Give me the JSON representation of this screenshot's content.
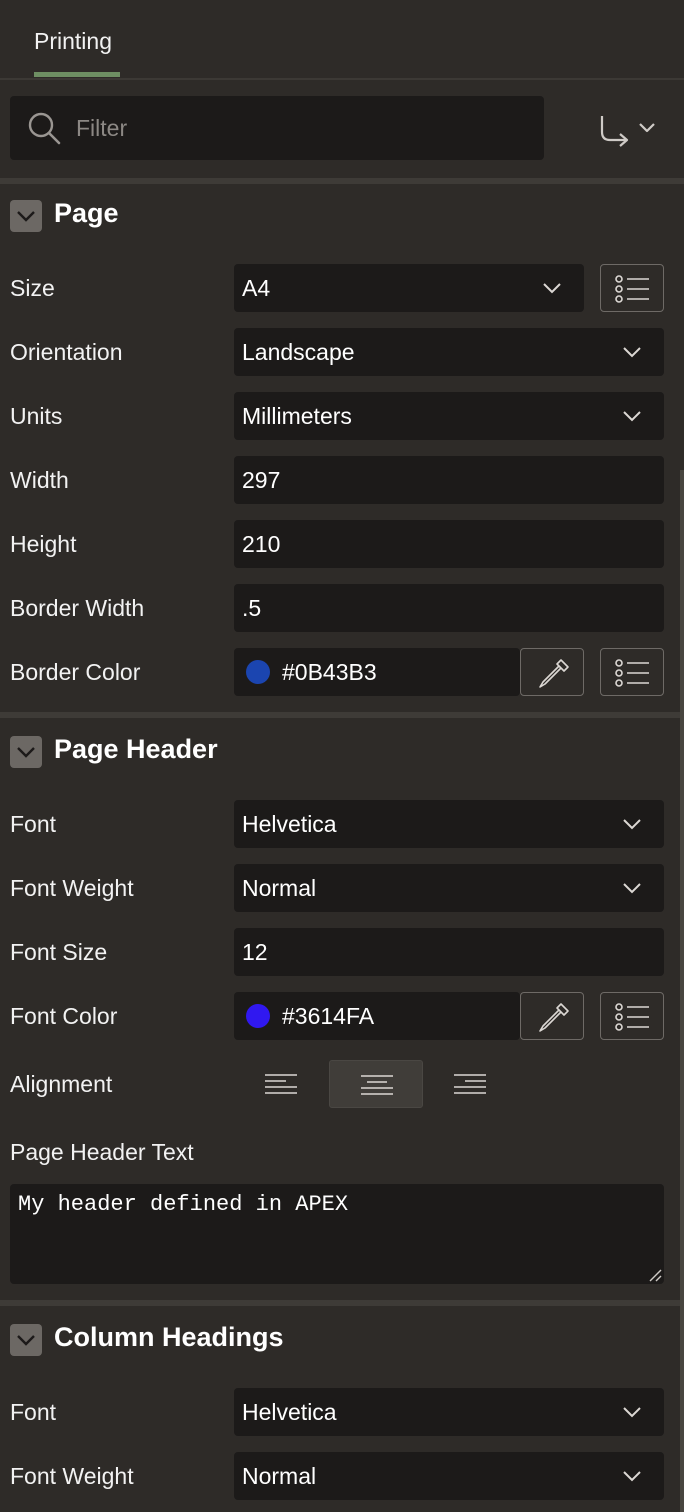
{
  "tabs": [
    {
      "label": "Printing",
      "active": true
    }
  ],
  "filter": {
    "placeholder": "Filter",
    "value": ""
  },
  "icons": {
    "search": "search-icon",
    "goto": "go-to-arrow-icon",
    "chevron": "chevron-down-icon",
    "lov": "list-icon",
    "picker": "eyedropper-icon"
  },
  "sections": {
    "page": {
      "title": "Page",
      "size": {
        "label": "Size",
        "value": "A4"
      },
      "orientation": {
        "label": "Orientation",
        "value": "Landscape"
      },
      "units": {
        "label": "Units",
        "value": "Millimeters"
      },
      "width": {
        "label": "Width",
        "value": "297"
      },
      "height": {
        "label": "Height",
        "value": "210"
      },
      "border_width": {
        "label": "Border Width",
        "value": ".5"
      },
      "border_color": {
        "label": "Border Color",
        "value": "#0B43B3",
        "swatch": "#1b45b0"
      }
    },
    "page_header": {
      "title": "Page Header",
      "font": {
        "label": "Font",
        "value": "Helvetica"
      },
      "font_weight": {
        "label": "Font Weight",
        "value": "Normal"
      },
      "font_size": {
        "label": "Font Size",
        "value": "12"
      },
      "font_color": {
        "label": "Font Color",
        "value": "#3614FA",
        "swatch": "#3018f0"
      },
      "alignment": {
        "label": "Alignment",
        "options": [
          "left",
          "center",
          "right"
        ],
        "selected": "center"
      },
      "text": {
        "label": "Page Header Text",
        "value": "My header defined in APEX"
      }
    },
    "column_headings": {
      "title": "Column Headings",
      "font": {
        "label": "Font",
        "value": "Helvetica"
      },
      "font_weight": {
        "label": "Font Weight",
        "value": "Normal"
      }
    }
  }
}
